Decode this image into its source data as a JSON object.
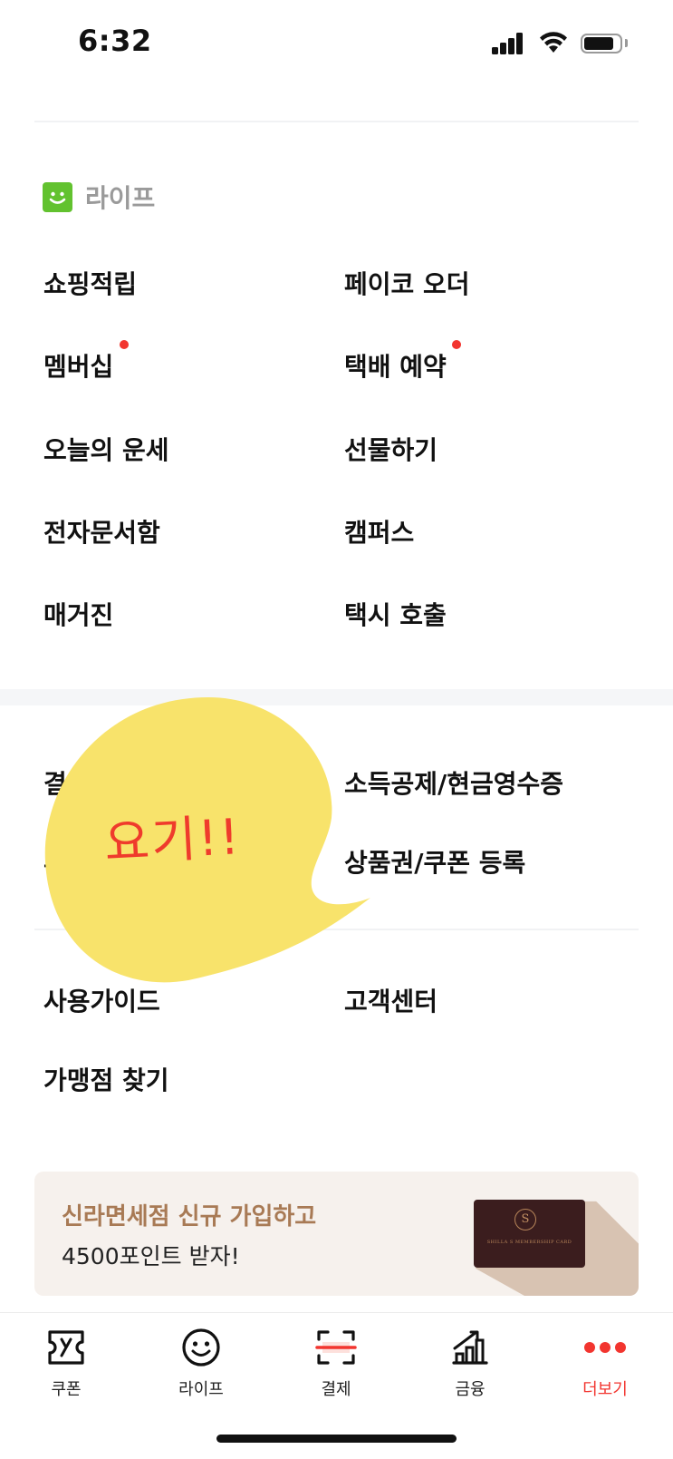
{
  "status_bar": {
    "time": "6:32"
  },
  "life": {
    "title": "라이프",
    "left_items": [
      {
        "label": "쇼핑적립",
        "dot": false
      },
      {
        "label": "멤버십",
        "dot": true
      },
      {
        "label": "오늘의 운세",
        "dot": false
      },
      {
        "label": "전자문서함",
        "dot": false
      },
      {
        "label": "매거진",
        "dot": false
      }
    ],
    "right_items": [
      {
        "label": "페이코 오더",
        "dot": false
      },
      {
        "label": "택배 예약",
        "dot": true
      },
      {
        "label": "선물하기",
        "dot": false
      },
      {
        "label": "캠퍼스",
        "dot": false
      },
      {
        "label": "택시 호출",
        "dot": false
      }
    ]
  },
  "payment_section": {
    "left_partial": [
      "결",
      "ㅗ"
    ],
    "right_items": [
      "소득공제/현금영수증",
      "상품권/쿠폰 등록"
    ]
  },
  "help_section": {
    "items": [
      "사용가이드",
      "고객센터",
      "가맹점 찾기"
    ]
  },
  "banner": {
    "title": "신라면세점 신규 가입하고",
    "subtitle": "4500포인트 받자!",
    "card_text": "SHILLA S MEMBERSHIP CARD",
    "card_emblem": "S"
  },
  "annotation": {
    "text": "요기!!"
  },
  "tabbar": {
    "tabs": [
      {
        "label": "쿠폰",
        "icon": "coupon-icon",
        "active": false
      },
      {
        "label": "라이프",
        "icon": "smile-icon",
        "active": false
      },
      {
        "label": "결제",
        "icon": "scan-icon",
        "active": false
      },
      {
        "label": "금융",
        "icon": "chart-icon",
        "active": false
      },
      {
        "label": "더보기",
        "icon": "more-dots-icon",
        "active": true
      }
    ]
  },
  "colors": {
    "accent_red": "#f2352f",
    "life_green": "#62c22f",
    "bubble_yellow": "#f8e36b",
    "banner_brown": "#a87a55"
  }
}
